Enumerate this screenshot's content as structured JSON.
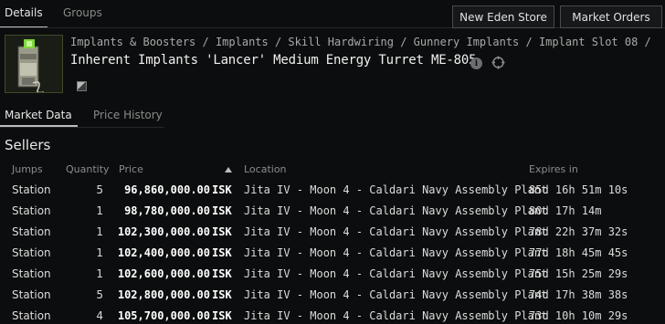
{
  "tabs": {
    "details": "Details",
    "groups": "Groups"
  },
  "buttons": {
    "new_eden_store": "New Eden Store",
    "market_orders": "Market Orders"
  },
  "item": {
    "breadcrumb": "Implants & Boosters / Implants / Skill Hardwiring / Gunnery Implants / Implant Slot 08 /",
    "title": "Inherent Implants 'Lancer' Medium Energy Turret ME-805",
    "icon": "implant-icon"
  },
  "sub_tabs": {
    "market_data": "Market Data",
    "price_history": "Price History"
  },
  "sellers": {
    "title": "Sellers",
    "columns": {
      "jumps": "Jumps",
      "quantity": "Quantity",
      "price": "Price",
      "location": "Location",
      "expires": "Expires in"
    },
    "rows": [
      {
        "jumps": "Station",
        "quantity": "5",
        "price": "96,860,000.00",
        "currency": "ISK",
        "location": "Jita IV - Moon 4 - Caldari Navy Assembly Plant",
        "expires": "85d 16h 51m 10s"
      },
      {
        "jumps": "Station",
        "quantity": "1",
        "price": "98,780,000.00",
        "currency": "ISK",
        "location": "Jita IV - Moon 4 - Caldari Navy Assembly Plant",
        "expires": "80d 17h 14m"
      },
      {
        "jumps": "Station",
        "quantity": "1",
        "price": "102,300,000.00",
        "currency": "ISK",
        "location": "Jita IV - Moon 4 - Caldari Navy Assembly Plant",
        "expires": "78d 22h 37m 32s"
      },
      {
        "jumps": "Station",
        "quantity": "1",
        "price": "102,400,000.00",
        "currency": "ISK",
        "location": "Jita IV - Moon 4 - Caldari Navy Assembly Plant",
        "expires": "77d 18h 45m 45s"
      },
      {
        "jumps": "Station",
        "quantity": "1",
        "price": "102,600,000.00",
        "currency": "ISK",
        "location": "Jita IV - Moon 4 - Caldari Navy Assembly Plant",
        "expires": "75d 15h 25m 29s"
      },
      {
        "jumps": "Station",
        "quantity": "5",
        "price": "102,800,000.00",
        "currency": "ISK",
        "location": "Jita IV - Moon 4 - Caldari Navy Assembly Plant",
        "expires": "74d 17h 38m 38s"
      },
      {
        "jumps": "Station",
        "quantity": "4",
        "price": "105,700,000.00",
        "currency": "ISK",
        "location": "Jita IV - Moon 4 - Caldari Navy Assembly Plant",
        "expires": "73d 10h 10m 29s"
      }
    ]
  }
}
